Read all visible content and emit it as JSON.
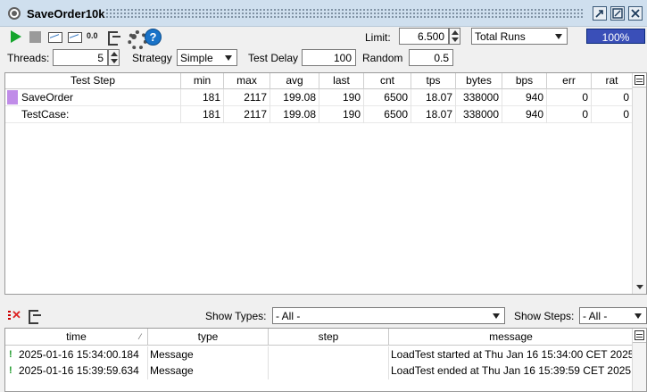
{
  "window": {
    "title": "SaveOrder10k"
  },
  "toolbar": {
    "zero_label": "0.0",
    "limit_label": "Limit:",
    "limit_value": "6.500",
    "limit_type": "Total Runs",
    "progress_text": "100%",
    "progress_fraction": 1.0
  },
  "settings": {
    "threads_label": "Threads:",
    "threads_value": "5",
    "strategy_label": "Strategy",
    "strategy_value": "Simple",
    "test_delay_label": "Test Delay",
    "test_delay_value": "100",
    "random_label": "Random",
    "random_value": "0.5"
  },
  "stats_table": {
    "headers": [
      "Test Step",
      "min",
      "max",
      "avg",
      "last",
      "cnt",
      "tps",
      "bytes",
      "bps",
      "err",
      "rat"
    ],
    "rows": [
      {
        "name": "SaveOrder",
        "swatch": "#c08ce8",
        "min": "181",
        "max": "2117",
        "avg": "199.08",
        "last": "190",
        "cnt": "6500",
        "tps": "18.07",
        "bytes": "338000",
        "bps": "940",
        "err": "0",
        "rat": "0"
      },
      {
        "name": "TestCase:",
        "swatch": "",
        "min": "181",
        "max": "2117",
        "avg": "199.08",
        "last": "190",
        "cnt": "6500",
        "tps": "18.07",
        "bytes": "338000",
        "bps": "940",
        "err": "0",
        "rat": "0"
      }
    ]
  },
  "log_filters": {
    "show_types_label": "Show Types:",
    "show_types_value": "- All -",
    "show_steps_label": "Show Steps:",
    "show_steps_value": "- All -"
  },
  "log_table": {
    "headers": [
      "time",
      "type",
      "step",
      "message"
    ],
    "sort_indicator": "⁄",
    "rows": [
      {
        "time": "2025-01-16 15:34:00.184",
        "type": "Message",
        "step": "",
        "message": "LoadTest started at Thu Jan 16 15:34:00 CET 2025"
      },
      {
        "time": "2025-01-16 15:39:59.634",
        "type": "Message",
        "step": "",
        "message": "LoadTest ended at Thu Jan 16 15:39:59 CET 2025"
      }
    ]
  },
  "icons": [
    "run-icon",
    "stop-icon",
    "graph-icon",
    "graph-icon",
    "reset-icon",
    "export-icon",
    "gear-icon",
    "help-icon",
    "clear-log-icon",
    "export-log-icon"
  ]
}
